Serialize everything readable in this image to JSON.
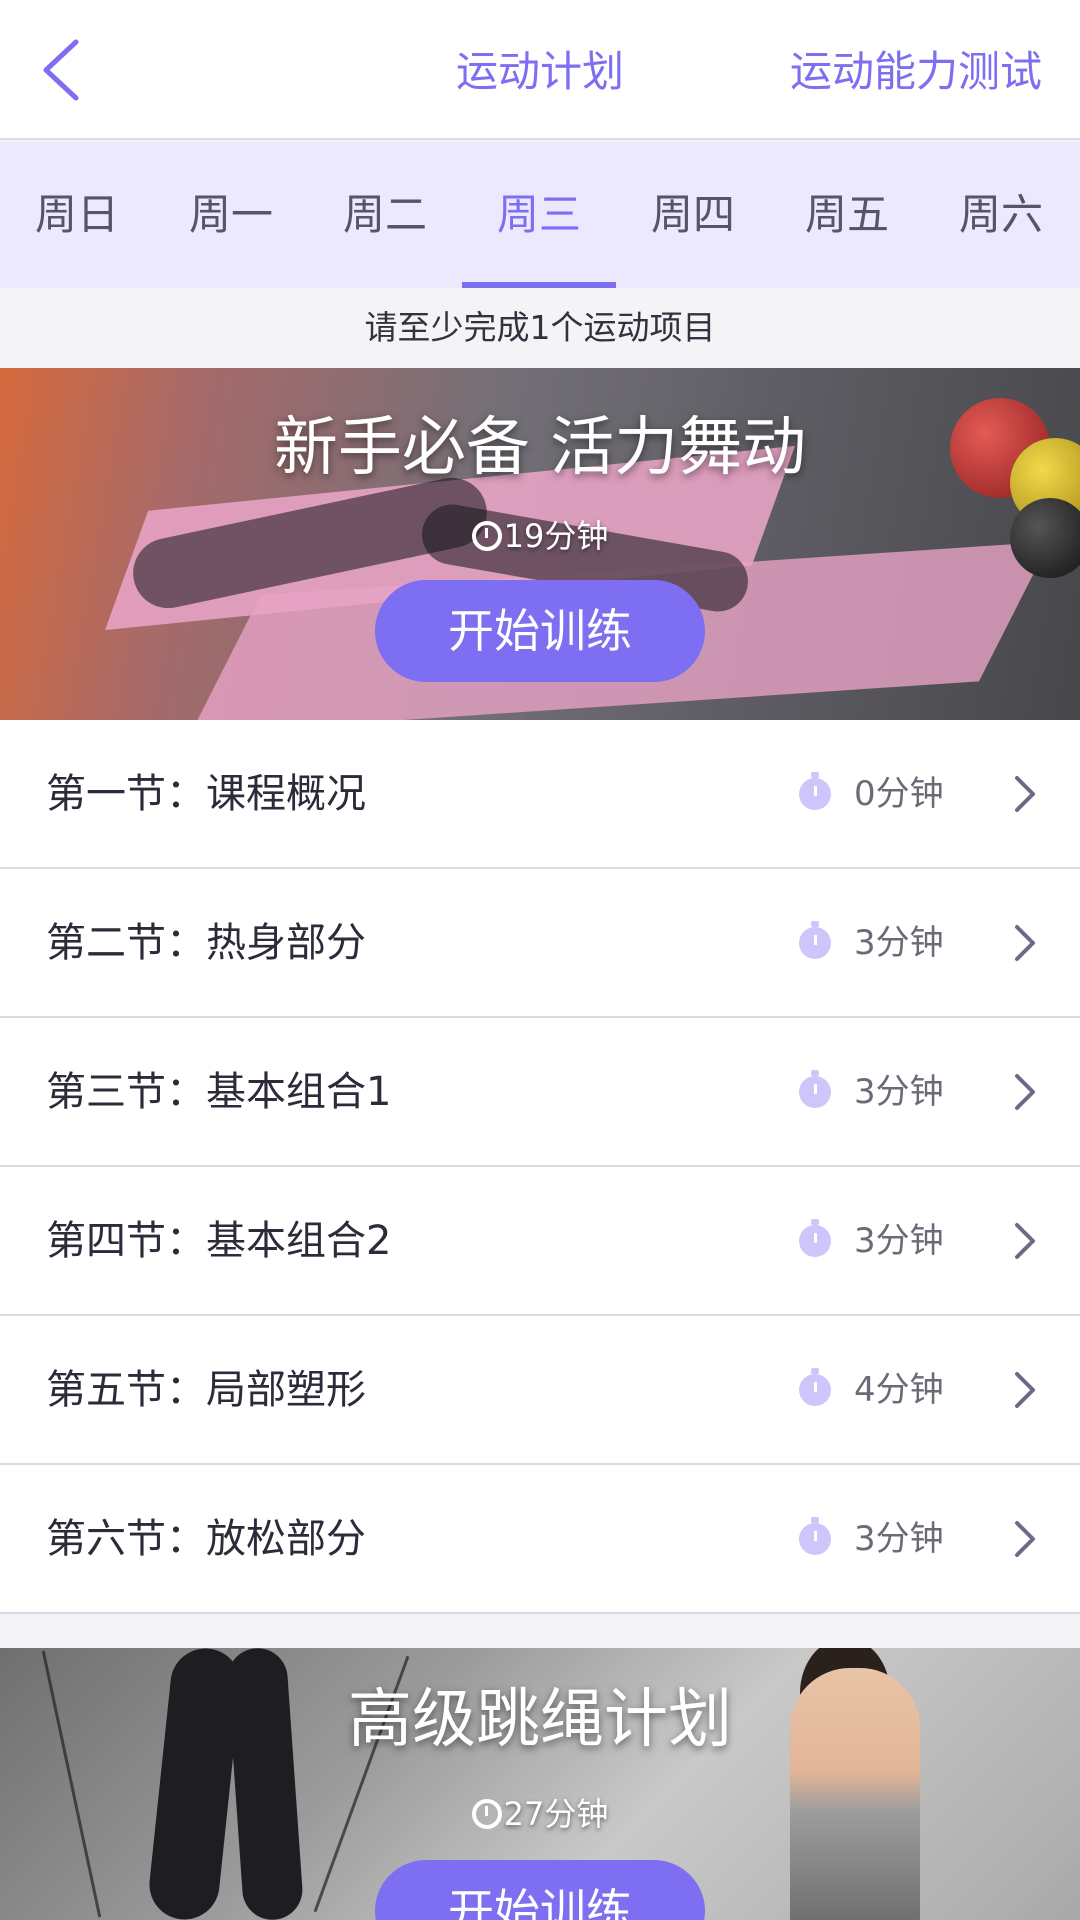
{
  "header": {
    "title": "运动计划",
    "right_link": "运动能力测试"
  },
  "week_tabs": [
    {
      "label": "周日"
    },
    {
      "label": "周一"
    },
    {
      "label": "周二"
    },
    {
      "label": "周三",
      "active": true
    },
    {
      "label": "周四"
    },
    {
      "label": "周五"
    },
    {
      "label": "周六"
    }
  ],
  "notice": "请至少完成1个运动项目",
  "plans": [
    {
      "title": "新手必备  活力舞动",
      "duration": "19分钟",
      "button": "开始训练"
    },
    {
      "title": "高级跳绳计划",
      "duration": "27分钟",
      "button": "开始训练"
    }
  ],
  "sections": [
    {
      "label": "第一节：课程概况",
      "duration": "0分钟"
    },
    {
      "label": "第二节：热身部分",
      "duration": "3分钟"
    },
    {
      "label": "第三节：基本组合1",
      "duration": "3分钟"
    },
    {
      "label": "第四节：基本组合2",
      "duration": "3分钟"
    },
    {
      "label": "第五节：局部塑形",
      "duration": "4分钟"
    },
    {
      "label": "第六节：放松部分",
      "duration": "3分钟"
    }
  ],
  "colors": {
    "accent": "#7d6ef2",
    "tab_bg": "#ece9ff",
    "clock_icon": "#cec6fb"
  }
}
